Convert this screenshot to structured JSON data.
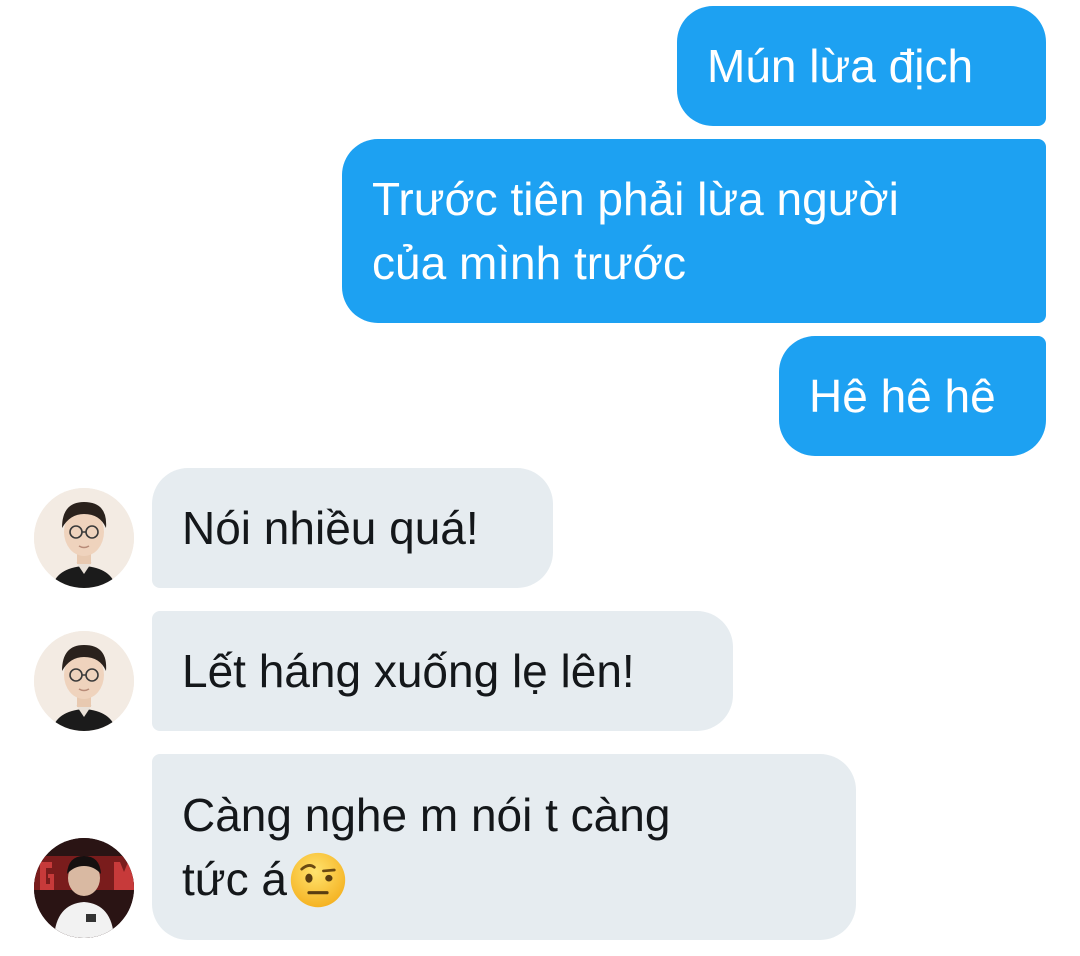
{
  "colors": {
    "outgoing_bubble": "#1da1f2",
    "outgoing_text": "#ffffff",
    "incoming_bubble": "#e6ecf0",
    "incoming_text": "#14171a"
  },
  "messages": [
    {
      "direction": "outgoing",
      "text": "Mún lừa địch"
    },
    {
      "direction": "outgoing",
      "lines": [
        "Trước tiên phải lừa người",
        "của mình trước"
      ]
    },
    {
      "direction": "outgoing",
      "text": "Hê hê hê"
    },
    {
      "direction": "incoming",
      "text": "Nói nhiều quá!",
      "avatar": "user-avatar-glasses-photo"
    },
    {
      "direction": "incoming",
      "text": "Lết háng xuống lẹ lên!",
      "avatar": "user-avatar-glasses-photo"
    },
    {
      "direction": "incoming",
      "lines": [
        "Càng nghe m nói t càng",
        "tức á"
      ],
      "emoji": "face-with-raised-eyebrow-emoji",
      "avatar": "user-avatar-team-jersey-photo"
    }
  ]
}
